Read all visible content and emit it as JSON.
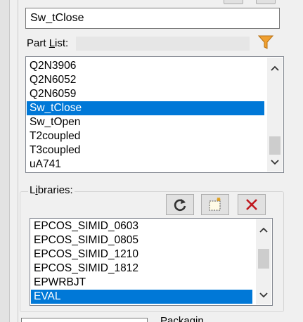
{
  "part_search": {
    "value": "Sw_tClose"
  },
  "part_list": {
    "label_prefix": "Part ",
    "label_underlined": "L",
    "label_suffix": "ist:",
    "items": [
      {
        "label": "Q2N3906",
        "selected": false
      },
      {
        "label": "Q2N6052",
        "selected": false
      },
      {
        "label": "Q2N6059",
        "selected": false
      },
      {
        "label": "Sw_tClose",
        "selected": true
      },
      {
        "label": "Sw_tOpen",
        "selected": false
      },
      {
        "label": "T2coupled",
        "selected": false
      },
      {
        "label": "T3coupled",
        "selected": false
      },
      {
        "label": "uA741",
        "selected": false
      }
    ]
  },
  "libraries": {
    "label_prefix": "L",
    "label_underlined": "i",
    "label_suffix": "braries:",
    "items": [
      {
        "label": "EPCOS_SIMID_0603",
        "selected": false
      },
      {
        "label": "EPCOS_SIMID_0805",
        "selected": false
      },
      {
        "label": "EPCOS_SIMID_1210",
        "selected": false
      },
      {
        "label": "EPCOS_SIMID_1812",
        "selected": false
      },
      {
        "label": "EPWRBJT",
        "selected": false
      },
      {
        "label": "EVAL",
        "selected": true
      }
    ]
  },
  "bottom": {
    "label": "Packagin"
  },
  "colors": {
    "selection": "#0078d7",
    "filter_icon": "#f0a030",
    "delete_icon": "#c0181e"
  },
  "icons": {
    "filter": "funnel-icon",
    "refresh": "refresh-icon",
    "add": "add-library-icon",
    "remove": "remove-library-icon",
    "scroll_up": "chevron-up-icon",
    "scroll_down": "chevron-down-icon"
  }
}
